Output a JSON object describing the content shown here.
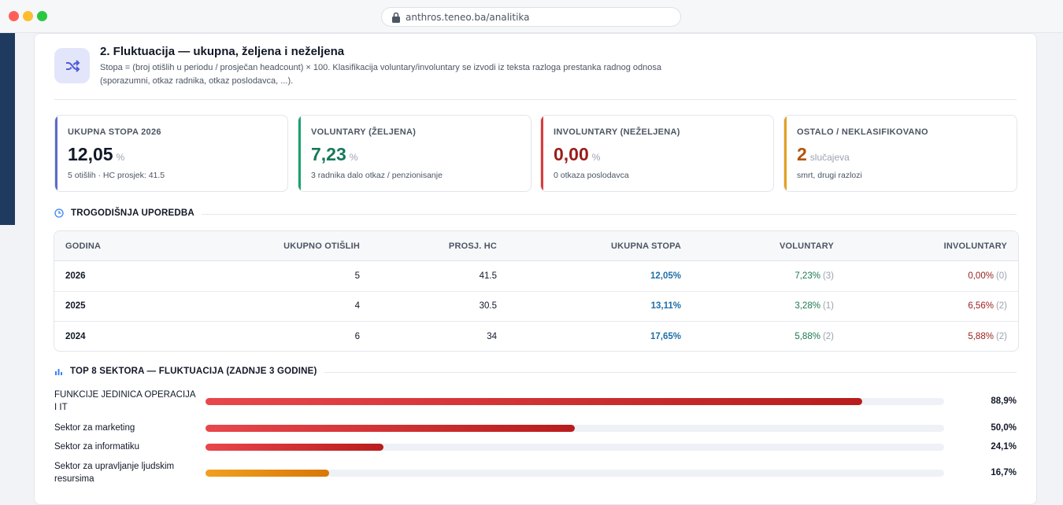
{
  "browser": {
    "url": "anthros.teneo.ba/analitika"
  },
  "section": {
    "title": "2. Fluktuacija — ukupna, željena i neželjena",
    "description": "Stopa = (broj otišlih u periodu / prosječan headcount) × 100. Klasifikacija voluntary/involuntary se izvodi iz teksta razloga prestanka radnog odnosa (sporazumni, otkaz radnika, otkaz poslodavca, ...)."
  },
  "kpis": [
    {
      "label": "UKUPNA STOPA 2026",
      "value": "12,05",
      "unit": "%",
      "sub": "5 otišlih · HC prosjek: 41.5",
      "accent": "#5b6bc9",
      "value_color": "#111827"
    },
    {
      "label": "VOLUNTARY (ŽELJENA)",
      "value": "7,23",
      "unit": "%",
      "sub": "3 radnika dalo otkaz / penzionisanje",
      "accent": "#1aa36b",
      "value_color": "#17795a"
    },
    {
      "label": "INVOLUNTARY (NEŽELJENA)",
      "value": "0,00",
      "unit": "%",
      "sub": "0 otkaza poslodavca",
      "accent": "#dc3b3b",
      "value_color": "#9b1c1c"
    },
    {
      "label": "OSTALO / NEKLASIFIKOVANO",
      "value": "2",
      "unit": "slučajeva",
      "sub": "smrt, drugi razlozi",
      "accent": "#e3a020",
      "value_color": "#b45309"
    }
  ],
  "comparison": {
    "heading": "TROGODIŠNJA UPOREDBA",
    "columns": [
      "GODINA",
      "UKUPNO OTIŠLIH",
      "PROSJ. HC",
      "UKUPNA STOPA",
      "VOLUNTARY",
      "INVOLUNTARY"
    ],
    "rows": [
      {
        "year": "2026",
        "total": "5",
        "hc": "41.5",
        "rate": "12,05%",
        "vol": "7,23%",
        "vol_n": "(3)",
        "inv": "0,00%",
        "inv_n": "(0)"
      },
      {
        "year": "2025",
        "total": "4",
        "hc": "30.5",
        "rate": "13,11%",
        "vol": "3,28%",
        "vol_n": "(1)",
        "inv": "6,56%",
        "inv_n": "(2)"
      },
      {
        "year": "2024",
        "total": "6",
        "hc": "34",
        "rate": "17,65%",
        "vol": "5,88%",
        "vol_n": "(2)",
        "inv": "5,88%",
        "inv_n": "(2)"
      }
    ]
  },
  "sectors": {
    "heading": "TOP 8 SEKTORA — FLUKTUACIJA (ZADNJE 3 GODINE)",
    "colors": {
      "high": "#c62828",
      "medium": "#d97706"
    },
    "items": [
      {
        "name": "FUNKCIJE JEDINICA OPERACIJA I IT",
        "pct_label": "88,9%",
        "value": 88.9,
        "level": "red"
      },
      {
        "name": "Sektor za marketing",
        "pct_label": "50,0%",
        "value": 50.0,
        "level": "red"
      },
      {
        "name": "Sektor za informatiku",
        "pct_label": "24,1%",
        "value": 24.1,
        "level": "red"
      },
      {
        "name": "Sektor za upravljanje ljudskim resursima",
        "pct_label": "16,7%",
        "value": 16.7,
        "level": "orange"
      }
    ]
  }
}
